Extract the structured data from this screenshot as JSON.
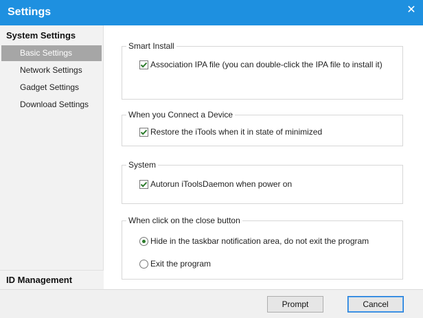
{
  "window": {
    "title": "Settings",
    "close_glyph": "✕"
  },
  "sidebar": {
    "section_title": "System Settings",
    "items": [
      {
        "label": "Basic Settings",
        "active": true
      },
      {
        "label": "Network Settings",
        "active": false
      },
      {
        "label": "Gadget Settings",
        "active": false
      },
      {
        "label": "Download Settings",
        "active": false
      }
    ],
    "bottom_section_title": "ID Management"
  },
  "groups": {
    "smart_install": {
      "legend": "Smart Install",
      "option": {
        "label": "Association IPA file (you can double-click the IPA file to install it)",
        "checked": true
      }
    },
    "connect_device": {
      "legend": "When you Connect a Device",
      "option": {
        "label": "Restore the iTools when it in state of minimized",
        "checked": true
      }
    },
    "system": {
      "legend": "System",
      "option": {
        "label": "Autorun iToolsDaemon when power on",
        "checked": true
      }
    },
    "close_button": {
      "legend": "When click on the close button",
      "options": [
        {
          "label": "Hide in the taskbar notification area, do not exit the program",
          "selected": true
        },
        {
          "label": "Exit the program",
          "selected": false
        }
      ]
    }
  },
  "footer": {
    "prompt_label": "Prompt",
    "cancel_label": "Cancel"
  },
  "colors": {
    "titlebar": "#1e90e0",
    "sidebar_active": "#a6a6a6",
    "check": "#2a7a2a"
  }
}
